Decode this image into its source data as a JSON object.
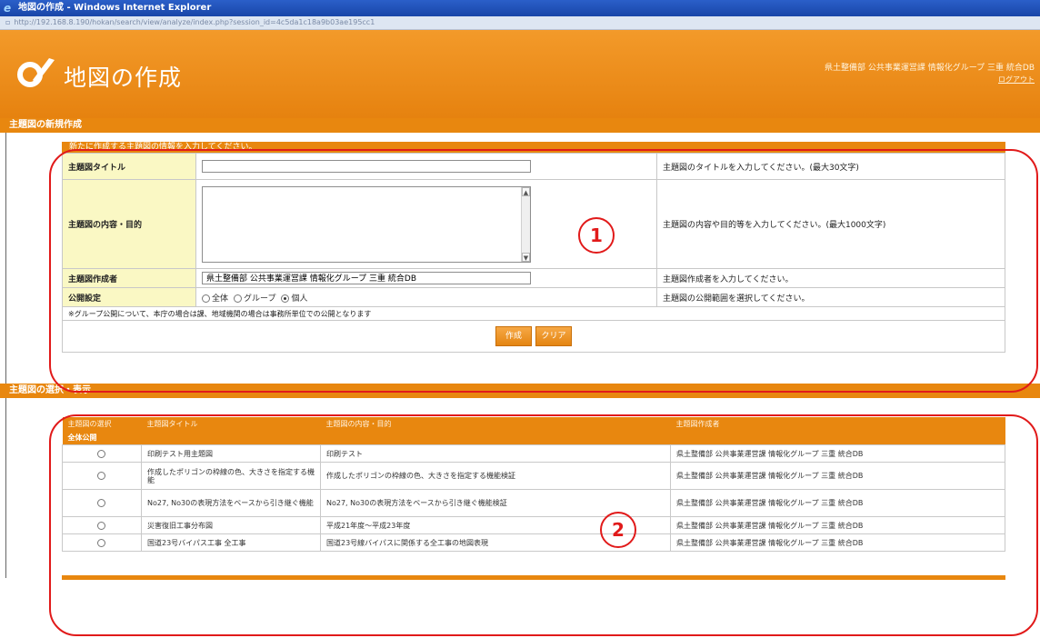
{
  "browser": {
    "title": "地図の作成 - Windows Internet Explorer",
    "url": "http://192.168.8.190/hokan/search/view/analyze/index.php?session_id=4c5da1c18a9b03ae195cc1"
  },
  "header": {
    "app_title": "地図の作成",
    "user_info": "県土整備部 公共事業運営課 情報化グループ 三重 統合DB",
    "logout": "ログアウト"
  },
  "new_section": {
    "bar_title": "主題図の新規作成",
    "caption": "新たに作成する主題図の情報を入力してください。",
    "fields": {
      "title_label": "主題図タイトル",
      "title_value": "",
      "title_help": "主題図のタイトルを入力してください。(最大30文字)",
      "content_label": "主題図の内容・目的",
      "content_value": "",
      "content_help": "主題図の内容や目的等を入力してください。(最大1000文字)",
      "author_label": "主題図作成者",
      "author_value": "県土整備部 公共事業運営課 情報化グループ 三重 統合DB",
      "author_help": "主題図作成者を入力してください。",
      "public_label": "公開設定",
      "public_options": [
        "全体",
        "グループ",
        "個人"
      ],
      "public_selected": "個人",
      "public_help": "主題図の公開範囲を選択してください。"
    },
    "note": "※グループ公開について、本庁の場合は課、地域機関の場合は事務所単位での公開となります",
    "buttons": {
      "create": "作成",
      "clear": "クリア"
    }
  },
  "list_section": {
    "bar_title": "主題図の選択・表示",
    "headers": [
      "主題図の選択",
      "主題図タイトル",
      "主題図の内容・目的",
      "主題図作成者"
    ],
    "group_label": "全体公開",
    "rows": [
      {
        "title": "印刷テスト用主題図",
        "content": "印刷テスト",
        "author": "県土整備部 公共事業運営課 情報化グループ 三重 統合DB"
      },
      {
        "title": "作成したポリゴンの枠線の色、大きさを指定する機能",
        "content": "作成したポリゴンの枠線の色、大きさを指定する機能検証",
        "author": "県土整備部 公共事業運営課 情報化グループ 三重 統合DB"
      },
      {
        "title": "No27, No30の表現方法をベースから引き継ぐ機能",
        "content": "No27, No30の表現方法をベースから引き継ぐ機能検証",
        "author": "県土整備部 公共事業運営課 情報化グループ 三重 統合DB"
      },
      {
        "title": "災害復旧工事分布図",
        "content": "平成21年度～平成23年度",
        "author": "県土整備部 公共事業運営課 情報化グループ 三重 統合DB"
      },
      {
        "title": "国道23号バイパス工事 全工事",
        "content": "国道23号線バイパスに関係する全工事の地図表現",
        "author": "県土整備部 公共事業運営課 情報化グループ 三重 統合DB"
      }
    ]
  },
  "annotations": {
    "one": "1",
    "two": "2"
  },
  "colors": {
    "accent": "#e8870f",
    "annotation": "#e11a1a",
    "label_bg": "#faf8c4"
  }
}
